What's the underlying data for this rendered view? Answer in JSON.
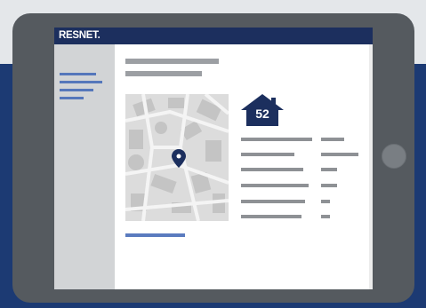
{
  "header": {
    "logo_text": "RESNET."
  },
  "score": {
    "value": "52"
  },
  "colors": {
    "navy": "#1c2f5e",
    "accent_blue": "#5a7bbf",
    "sidebar_gray": "#d2d4d6",
    "tablet_body": "#555a5f"
  },
  "icons": [
    "house-score-icon",
    "map-pin-icon"
  ]
}
